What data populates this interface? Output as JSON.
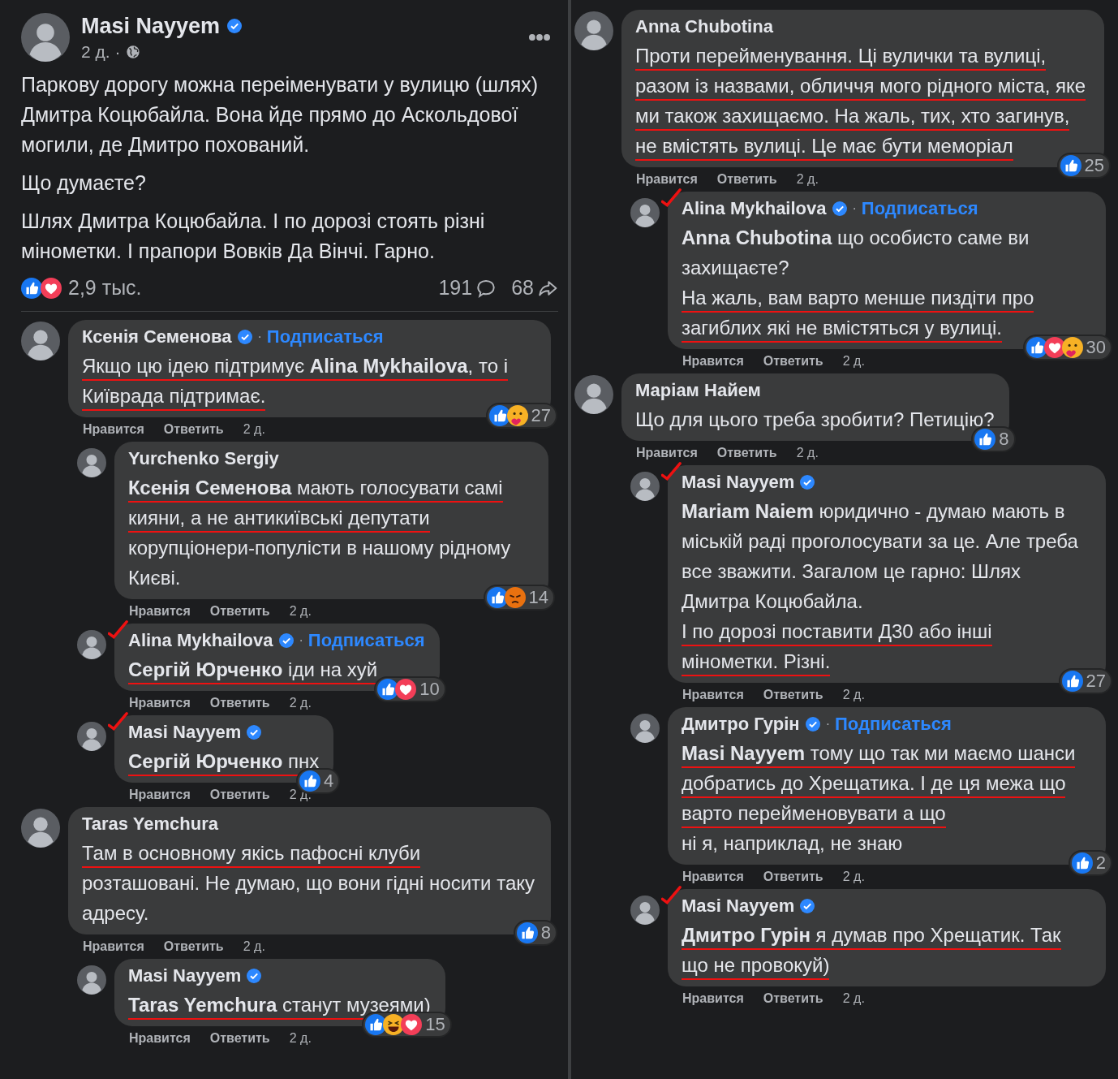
{
  "left_column": {
    "post": {
      "author": "Masi Nayyem",
      "verified": true,
      "time": "2 д.",
      "separator": "·",
      "paragraphs": [
        "Паркову дорогу можна переіменувати у вулицю (шлях) Дмитра Коцюбайла. Вона йде прямо до Аскольдової могили, де Дмитро похований.",
        "Що думаєте?",
        "Шлях Дмитра Коцюбайла. І по дорозі стоять різні мінометки. І прапори Вовків Да Вінчі. Гарно."
      ],
      "reactions": [
        {
          "kind": "like"
        },
        {
          "kind": "love"
        }
      ],
      "reaction_count": "2,9 тыс.",
      "comment_count": "191",
      "share_count": "68"
    },
    "comments": [
      {
        "author": "Ксенія Семенова",
        "verified": true,
        "separator": "·",
        "follow": "Подписаться",
        "annotated": false,
        "paragraphs": [
          {
            "text": "Якщо цю ідею підтримує **Alina Mykhailova**, то і Київрада підтримає.",
            "underlined": true
          }
        ],
        "reactions": [
          {
            "kind": "like"
          },
          {
            "kind": "care"
          }
        ],
        "reaction_count": "27",
        "like": "Нравится",
        "reply": "Ответить",
        "time": "2 д.",
        "children": [
          {
            "author": "Yurchenko Sergiy",
            "verified": false,
            "annotated": false,
            "paragraphs": [
              {
                "text": "**Ксенія Семенова** мають голосувати самі кияни, а не антикиївські депутати",
                "underlined": true
              },
              {
                "text": "корупціонери-популісти в нашому рідному Києві.",
                "underlined": false
              }
            ],
            "reactions": [
              {
                "kind": "like"
              },
              {
                "kind": "angry"
              }
            ],
            "reaction_count": "14",
            "like": "Нравится",
            "reply": "Ответить",
            "time": "2 д."
          },
          {
            "author": "Alina Mykhailova",
            "verified": true,
            "separator": "·",
            "follow": "Подписаться",
            "annotated": true,
            "paragraphs": [
              {
                "text": "**Сергій Юрченко** іди на хуй",
                "underlined": true
              }
            ],
            "reactions": [
              {
                "kind": "like"
              },
              {
                "kind": "love"
              }
            ],
            "reaction_count": "10",
            "like": "Нравится",
            "reply": "Ответить",
            "time": "2 д."
          },
          {
            "author": "Masi Nayyem",
            "verified": true,
            "annotated": true,
            "paragraphs": [
              {
                "text": "**Сергій Юрченко** пнх",
                "underlined": true
              }
            ],
            "reactions": [
              {
                "kind": "like"
              }
            ],
            "reaction_count": "4",
            "like": "Нравится",
            "reply": "Ответить",
            "time": "2 д."
          }
        ]
      },
      {
        "author": "Taras Yemchura",
        "verified": false,
        "annotated": false,
        "paragraphs": [
          {
            "text": "Там в основному якісь пафосні клуби",
            "underlined": true
          },
          {
            "text": "розташовані. Не думаю, що вони гідні носити таку адресу.",
            "underlined": false
          }
        ],
        "reactions": [
          {
            "kind": "like"
          }
        ],
        "reaction_count": "8",
        "like": "Нравится",
        "reply": "Ответить",
        "time": "2 д.",
        "children": [
          {
            "author": "Masi Nayyem",
            "verified": true,
            "annotated": false,
            "paragraphs": [
              {
                "text": "**Taras Yemchura** станут музеями)",
                "underlined": true
              }
            ],
            "reactions": [
              {
                "kind": "like"
              },
              {
                "kind": "haha"
              },
              {
                "kind": "love"
              }
            ],
            "reaction_count": "15",
            "like": "Нравится",
            "reply": "Ответить",
            "time": "2 д."
          }
        ]
      }
    ]
  },
  "right_column": {
    "comments": [
      {
        "author": "Anna Chubotina",
        "verified": false,
        "annotated": false,
        "paragraphs": [
          {
            "text": "Проти перейменування. Ці вулички та вулиці, разом із назвами, обличчя мого рідного міста, яке ми також захищаємо. На жаль, тих, хто загинув, не вмістять вулиці. Це має бути меморіал",
            "underlined": true
          }
        ],
        "reactions": [
          {
            "kind": "like"
          }
        ],
        "reaction_count": "25",
        "like": "Нравится",
        "reply": "Ответить",
        "time": "2 д.",
        "children": [
          {
            "author": "Alina Mykhailova",
            "verified": true,
            "separator": "·",
            "follow": "Подписаться",
            "annotated": true,
            "paragraphs": [
              {
                "text": "**Anna Chubotina** що особисто саме ви захищаєте?",
                "underlined": false
              },
              {
                "text": "На жаль, вам варто менше пиздіти про загиблих які не вмістяться у вулиці.",
                "underlined": true
              }
            ],
            "reactions": [
              {
                "kind": "like"
              },
              {
                "kind": "love"
              },
              {
                "kind": "care"
              }
            ],
            "reaction_count": "30",
            "like": "Нравится",
            "reply": "Ответить",
            "time": "2 д."
          }
        ]
      },
      {
        "author": "Маріам Найем",
        "verified": false,
        "annotated": false,
        "paragraphs": [
          {
            "text": "Що для цього треба зробити? Петицію?",
            "underlined": false
          }
        ],
        "reactions": [
          {
            "kind": "like"
          }
        ],
        "reaction_count": "8",
        "like": "Нравится",
        "reply": "Ответить",
        "time": "2 д.",
        "children": [
          {
            "author": "Masi Nayyem",
            "verified": true,
            "annotated": true,
            "paragraphs": [
              {
                "text": "**Mariam Naiem** юридично - думаю мають в міській раді проголосувати за це. Але треба все зважити. Загалом це гарно: Шлях Дмитра Коцюбайла.",
                "underlined": false
              },
              {
                "text": "І по дорозі поставити Д30 або інші мінометки. Різні.",
                "underlined": true
              }
            ],
            "reactions": [
              {
                "kind": "like"
              }
            ],
            "reaction_count": "27",
            "like": "Нравится",
            "reply": "Ответить",
            "time": "2 д."
          },
          {
            "author": "Дмитро Гурін",
            "verified": true,
            "separator": "·",
            "follow": "Подписаться",
            "annotated": false,
            "paragraphs": [
              {
                "text": "**Masi Nayyem** тому що так ми маємо шанси добратись до Хрещатика. І де ця межа що варто перейменовувати а що",
                "underlined": true
              },
              {
                "text": "ні я, наприклад, не знаю",
                "underlined": false
              }
            ],
            "reactions": [
              {
                "kind": "like"
              }
            ],
            "reaction_count": "2",
            "like": "Нравится",
            "reply": "Ответить",
            "time": "2 д."
          },
          {
            "author": "Masi Nayyem",
            "verified": true,
            "annotated": true,
            "paragraphs": [
              {
                "text": "**Дмитро Гурін** я думав про Хрещатик. Так що не провокуй)",
                "underlined": true
              }
            ],
            "like": "Нравится",
            "reply": "Ответить",
            "time": "2 д."
          }
        ]
      }
    ]
  }
}
